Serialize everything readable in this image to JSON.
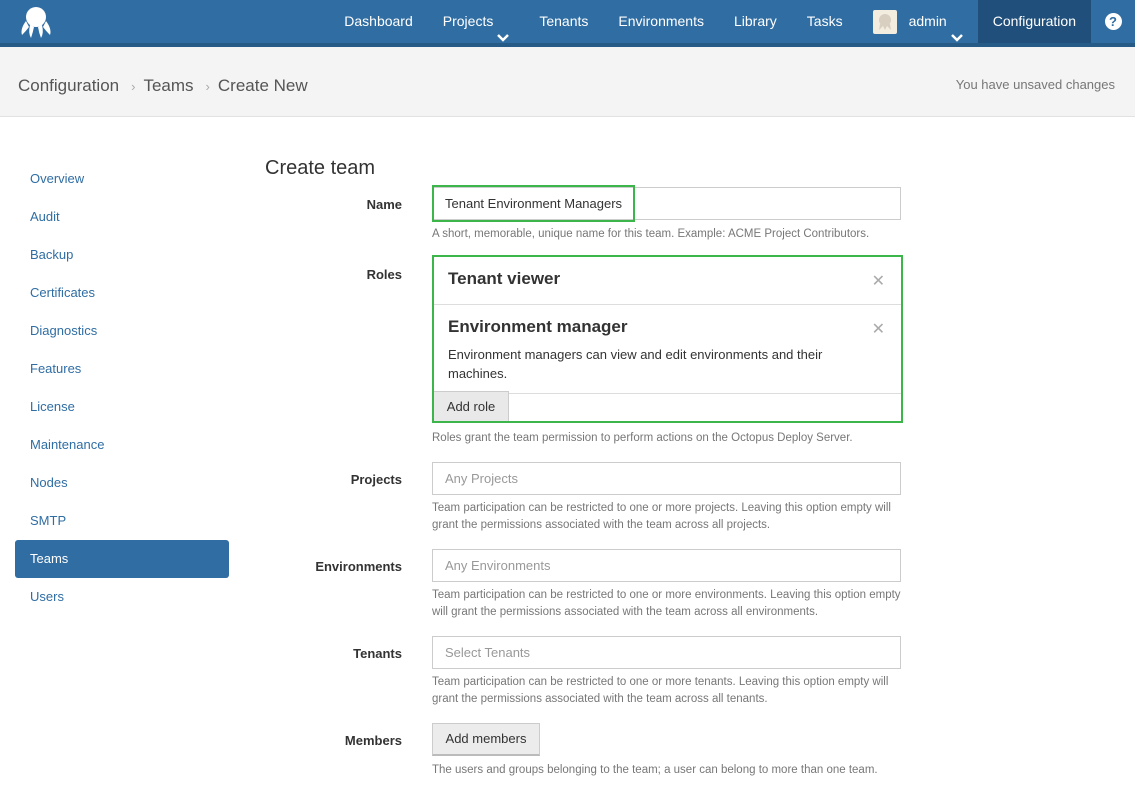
{
  "nav": {
    "items": [
      {
        "label": "Dashboard"
      },
      {
        "label": "Projects"
      },
      {
        "label": "Tenants"
      },
      {
        "label": "Environments"
      },
      {
        "label": "Library"
      },
      {
        "label": "Tasks"
      }
    ],
    "user": "admin",
    "configuration": "Configuration",
    "help": "?"
  },
  "breadcrumb": {
    "root": "Configuration",
    "section": "Teams",
    "current": "Create New",
    "status": "You have unsaved changes"
  },
  "sidebar": {
    "items": [
      {
        "label": "Overview"
      },
      {
        "label": "Audit"
      },
      {
        "label": "Backup"
      },
      {
        "label": "Certificates"
      },
      {
        "label": "Diagnostics"
      },
      {
        "label": "Features"
      },
      {
        "label": "License"
      },
      {
        "label": "Maintenance"
      },
      {
        "label": "Nodes"
      },
      {
        "label": "SMTP"
      },
      {
        "label": "Teams"
      },
      {
        "label": "Users"
      }
    ],
    "active": "Teams"
  },
  "form": {
    "title": "Create team",
    "name": {
      "label": "Name",
      "value": "Tenant Environment Managers",
      "help": "A short, memorable, unique name for this team. Example: ACME Project Contributors."
    },
    "roles": {
      "label": "Roles",
      "items": [
        {
          "title": "Tenant viewer",
          "description": ""
        },
        {
          "title": "Environment manager",
          "description": "Environment managers can view and edit environments and their machines."
        }
      ],
      "add_label": "Add role",
      "help": "Roles grant the team permission to perform actions on the Octopus Deploy Server."
    },
    "projects": {
      "label": "Projects",
      "placeholder": "Any Projects",
      "help": "Team participation can be restricted to one or more projects. Leaving this option empty will grant the permissions associated with the team across all projects."
    },
    "environments": {
      "label": "Environments",
      "placeholder": "Any Environments",
      "help": "Team participation can be restricted to one or more environments. Leaving this option empty will grant the permissions associated with the team across all environments."
    },
    "tenants": {
      "label": "Tenants",
      "placeholder": "Select Tenants",
      "help": "Team participation can be restricted to one or more tenants. Leaving this option empty will grant the permissions associated with the team across all tenants."
    },
    "members": {
      "label": "Members",
      "button": "Add members",
      "help": "The users and groups belonging to the team; a user can belong to more than one team."
    }
  },
  "colors": {
    "brand": "#2f6da3",
    "highlight": "#3cb54a"
  }
}
